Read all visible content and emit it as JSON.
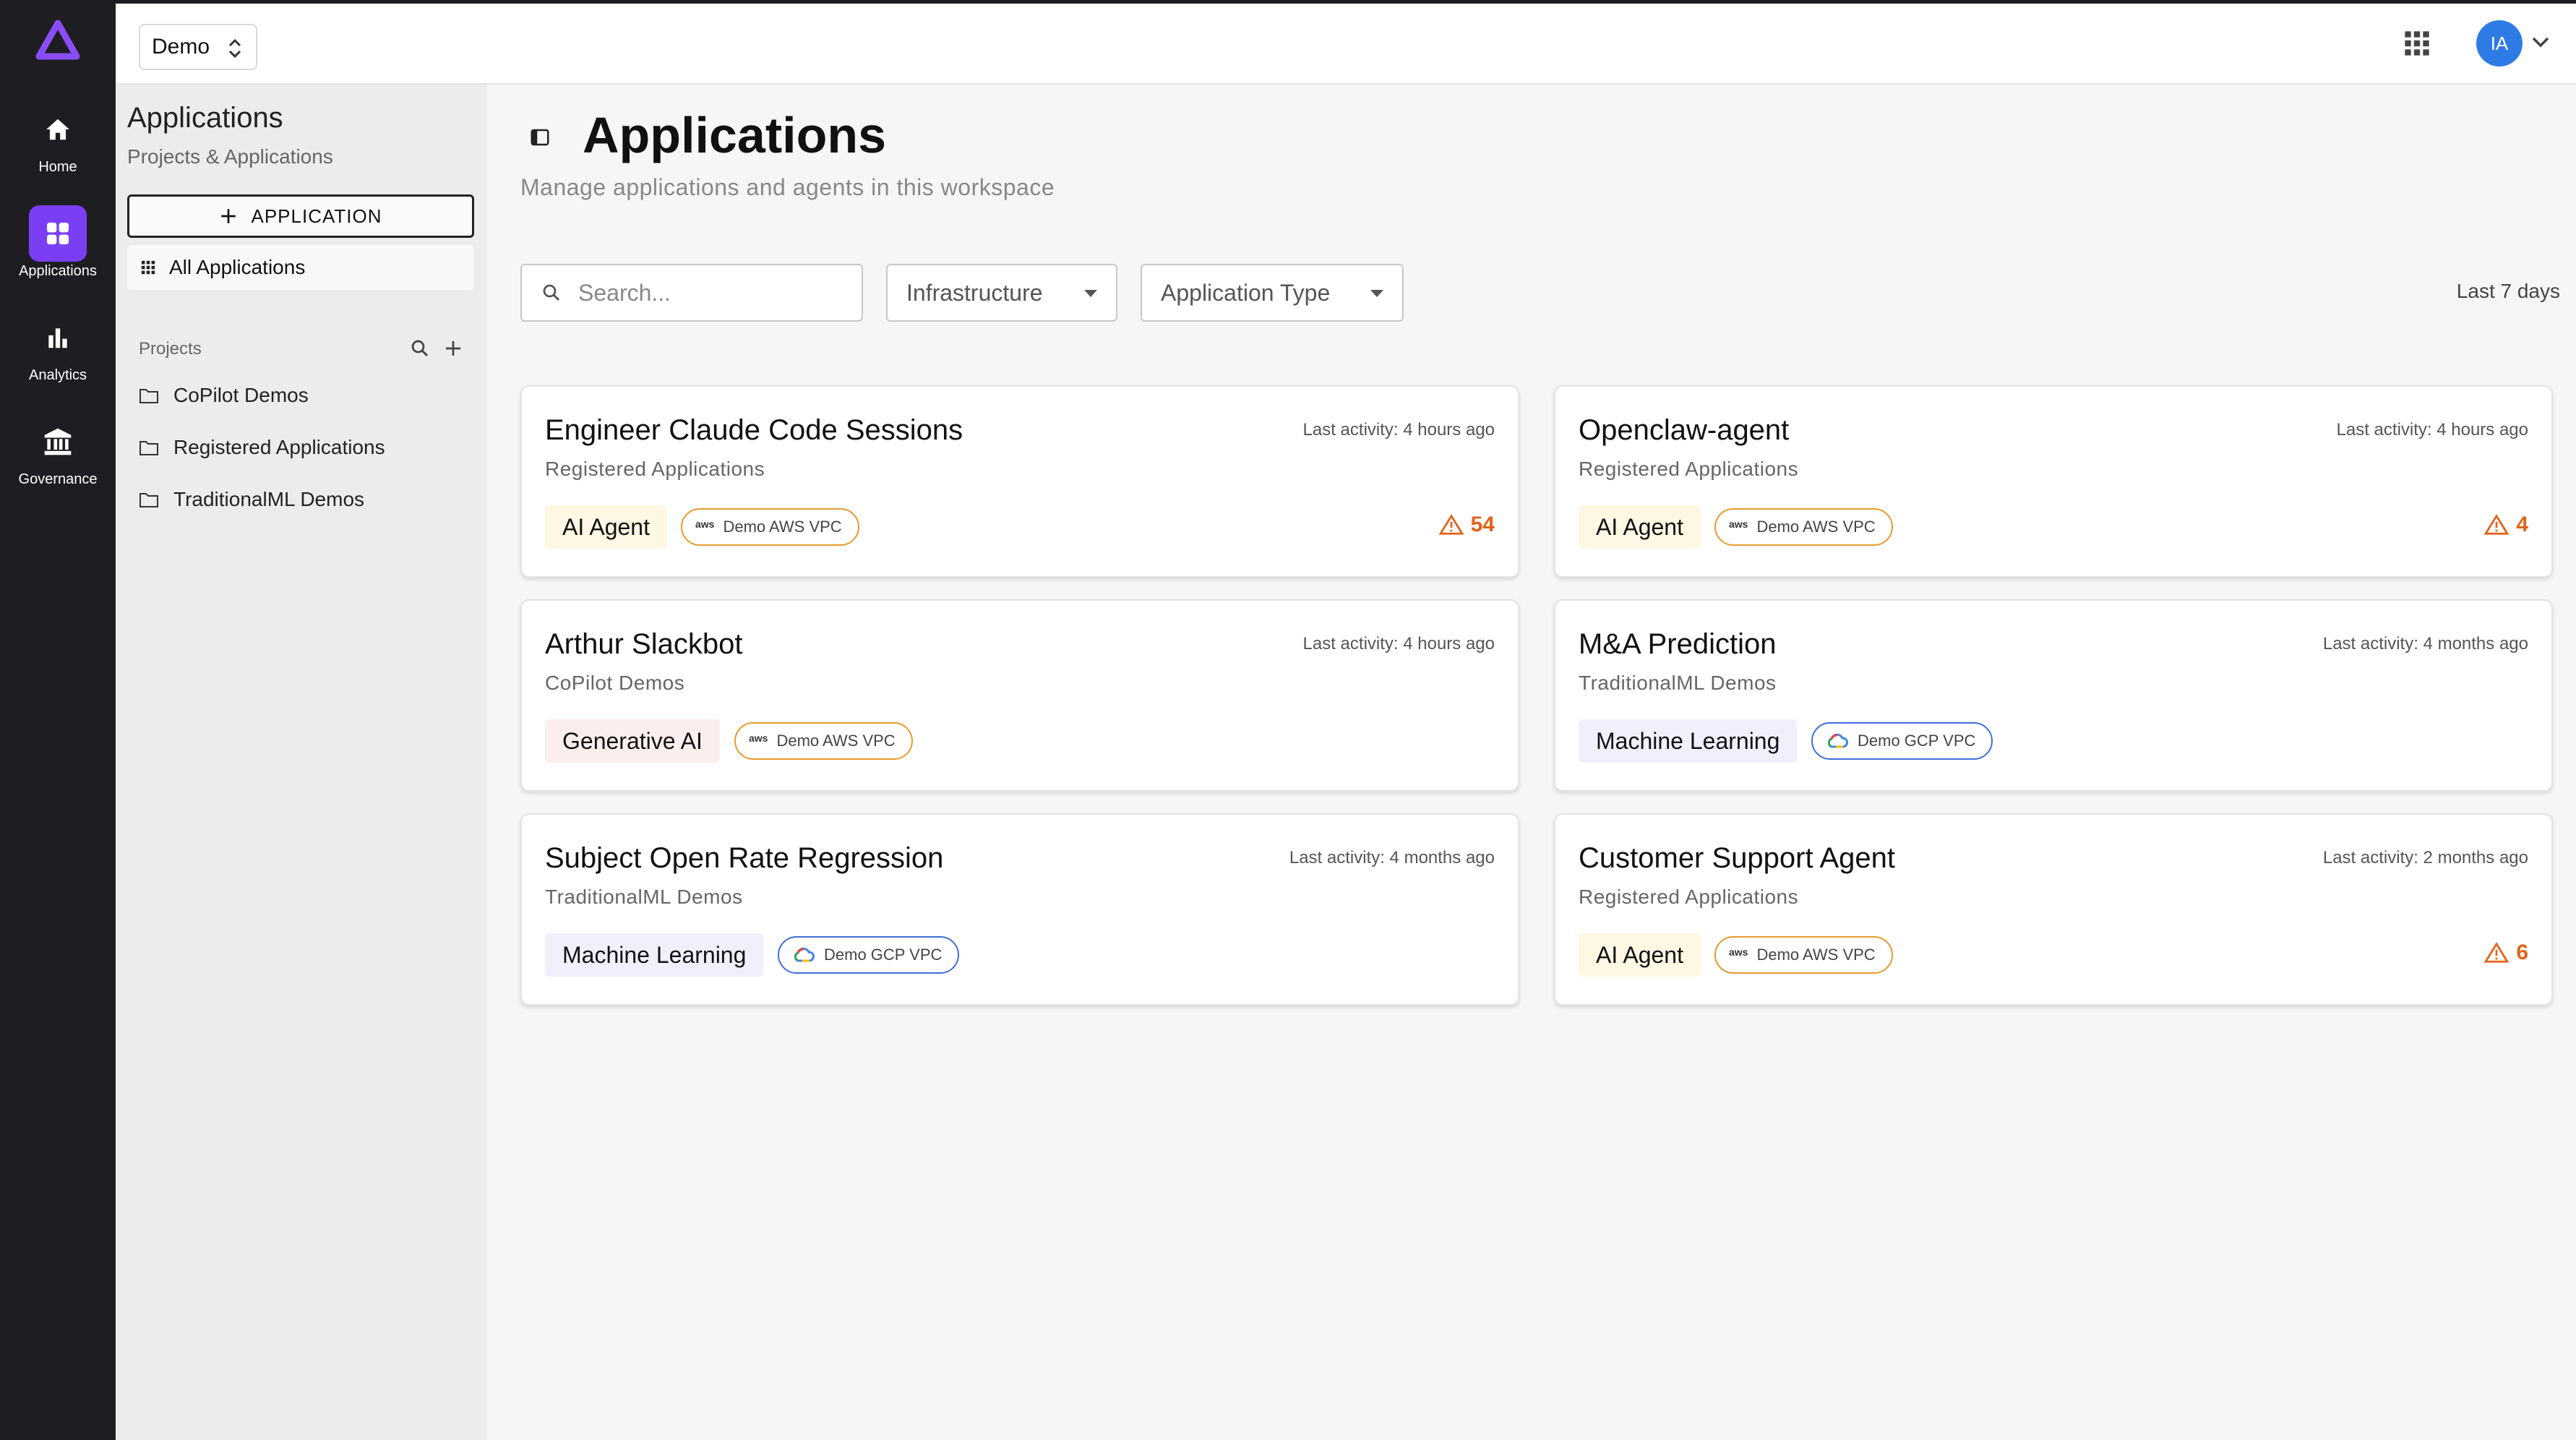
{
  "colors": {
    "rail_bg": "#1e1e22",
    "accent": "#7a3ff2",
    "alert": "#e2621b",
    "ai_agent_chip": "#fdf7e3",
    "genai_chip": "#fdeeee",
    "ml_chip": "#f2effc",
    "aws_border": "#e89a2e",
    "gcp_border": "#3f6fd8"
  },
  "rail": {
    "items": [
      {
        "label": "Home",
        "icon": "home-icon"
      },
      {
        "label": "Applications",
        "icon": "grid-icon"
      },
      {
        "label": "Analytics",
        "icon": "bar-chart-icon"
      },
      {
        "label": "Governance",
        "icon": "bank-icon"
      }
    ]
  },
  "topbar": {
    "workspace": "Demo",
    "avatar_initials": "IA"
  },
  "sidebar": {
    "title": "Applications",
    "subtitle": "Projects & Applications",
    "new_button": "APPLICATION",
    "all_label": "All Applications",
    "projects_label": "Projects",
    "projects": [
      "CoPilot Demos",
      "Registered Applications",
      "TraditionalML Demos"
    ]
  },
  "main": {
    "title": "Applications",
    "subtitle": "Manage applications and agents in this workspace",
    "search_placeholder": "Search...",
    "filter_infra": "Infrastructure",
    "filter_type": "Application Type",
    "date_range": "Last 7 days"
  },
  "cards": [
    {
      "title": "Engineer Claude Code Sessions",
      "project": "Registered Applications",
      "activity": "Last activity: 4 hours ago",
      "type": "AI Agent",
      "infra": "Demo AWS VPC",
      "alerts": "54"
    },
    {
      "title": "Openclaw-agent",
      "project": "Registered Applications",
      "activity": "Last activity: 4 hours ago",
      "type": "AI Agent",
      "infra": "Demo AWS VPC",
      "alerts": "4"
    },
    {
      "title": "Arthur Slackbot",
      "project": "CoPilot Demos",
      "activity": "Last activity: 4 hours ago",
      "type": "Generative AI",
      "infra": "Demo AWS VPC",
      "alerts": ""
    },
    {
      "title": "M&A Prediction",
      "project": "TraditionalML Demos",
      "activity": "Last activity: 4 months ago",
      "type": "Machine Learning",
      "infra": "Demo GCP VPC",
      "alerts": ""
    },
    {
      "title": "Subject Open Rate Regression",
      "project": "TraditionalML Demos",
      "activity": "Last activity: 4 months ago",
      "type": "Machine Learning",
      "infra": "Demo GCP VPC",
      "alerts": ""
    },
    {
      "title": "Customer Support Agent",
      "project": "Registered Applications",
      "activity": "Last activity: 2 months ago",
      "type": "AI Agent",
      "infra": "Demo AWS VPC",
      "alerts": "6"
    }
  ]
}
